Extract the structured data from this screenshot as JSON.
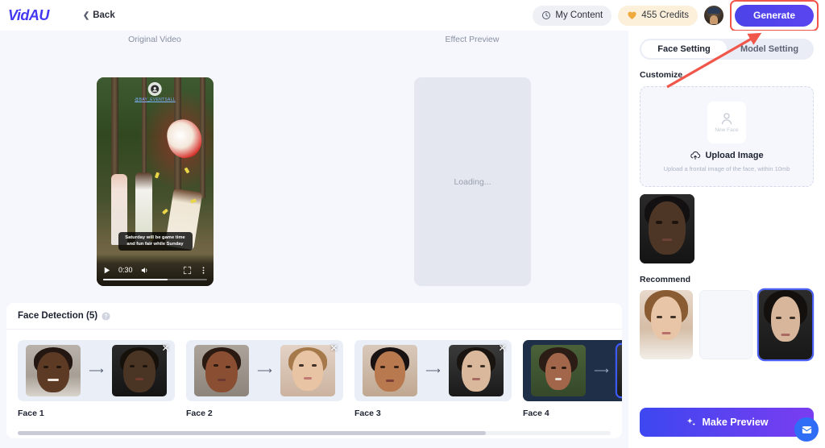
{
  "header": {
    "logo": "VidAU",
    "back_label": "Back",
    "back_icon": "chevron-left-icon",
    "my_content_label": "My Content",
    "my_content_icon": "clock-icon",
    "credits_label": "455 Credits",
    "credits_icon": "heart-coin-icon",
    "credits_count": 455,
    "avatar_icon": "user-avatar",
    "generate_label": "Generate",
    "generate_highlight_color": "#f0564a",
    "generate_bg_color": "#4b43e8"
  },
  "stage": {
    "original_label": "Original Video",
    "effect_label": "Effect Preview",
    "preview_loading_text": "Loading...",
    "video": {
      "watermark_text": "@BAY_EVENTSALL",
      "caption": "Saturday will be game time and fun fair while Sunday",
      "time": "0:30",
      "play_icon": "play-icon",
      "volume_icon": "volume-icon",
      "fullscreen_icon": "fullscreen-icon",
      "more_icon": "more-vertical-icon",
      "progress_percent": 62
    }
  },
  "face_detection": {
    "title": "Face Detection (5)",
    "count": 5,
    "help_icon": "help-circle-icon",
    "remove_icon": "close-icon",
    "arrow_icon": "arrow-right-icon",
    "cards": [
      {
        "name": "Face 1",
        "selected": false
      },
      {
        "name": "Face 2",
        "selected": false
      },
      {
        "name": "Face 3",
        "selected": false
      },
      {
        "name": "Face 4",
        "selected": true
      }
    ]
  },
  "right_panel": {
    "tabs": [
      {
        "label": "Face Setting",
        "active": true
      },
      {
        "label": "Model Setting",
        "active": false
      }
    ],
    "customize_label": "Customize",
    "upload": {
      "new_face_label": "New Face",
      "person_icon": "person-icon",
      "cloud_icon": "cloud-upload-icon",
      "upload_label": "Upload Image",
      "hint": "Upload a frontal image of the face, within 10mb"
    },
    "recommend_label": "Recommend",
    "recommend_cards": [
      {
        "selected": false,
        "empty": false
      },
      {
        "selected": false,
        "empty": true
      },
      {
        "selected": true,
        "empty": false
      }
    ],
    "make_preview_label": "Make Preview",
    "make_preview_icon": "sparkle-icon",
    "chat_icon": "chat-bubble-icon"
  }
}
